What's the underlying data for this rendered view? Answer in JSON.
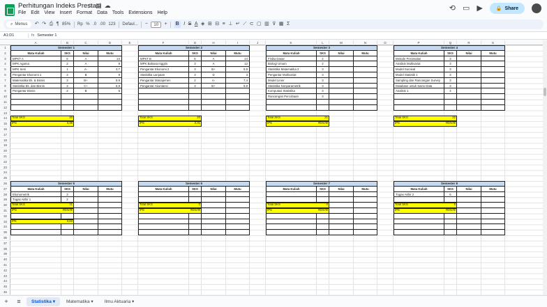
{
  "doc": {
    "title": "Perhitungan Indeks Prestasi"
  },
  "menu": [
    "File",
    "Edit",
    "View",
    "Insert",
    "Format",
    "Data",
    "Tools",
    "Extensions",
    "Help"
  ],
  "share_label": "Share",
  "toolbar": {
    "search": "Menus",
    "zoom": "85%",
    "currency": "Rp",
    "percent": "%",
    "dec1": ".0",
    "dec2": ".00",
    "numfmt": "123",
    "font": "Defaul...",
    "fontsize": "10"
  },
  "formula": {
    "cell": "A1:D1",
    "content": "Semester 1"
  },
  "columns": [
    "A",
    "B",
    "C",
    "D",
    "E",
    "F",
    "G",
    "H",
    "I",
    "J",
    "K",
    "L",
    "M",
    "N",
    "O",
    "P",
    "Q",
    "R",
    "S"
  ],
  "colors": {
    "header_band": "#c5d9f1",
    "highlight": "#ffff00",
    "active_tab": "#0b57d0"
  },
  "semesters": [
    {
      "title": "Semester 1",
      "headers": [
        "Mata Kuliah",
        "SKS",
        "Nilai",
        "Mutu"
      ],
      "rows": [
        [
          "MPKT A",
          "6",
          "A",
          "24"
        ],
        [
          "MPK Agama",
          "2",
          "A",
          "8"
        ],
        [
          "MPK Seni",
          "1",
          "A-",
          "3,7"
        ],
        [
          "Pengantar Ekonomi 1",
          "3",
          "B",
          "9"
        ],
        [
          "Matematika Ek. & Bisnis",
          "3",
          "B+",
          "9,9"
        ],
        [
          "Statistika Ek. dan Bisnis",
          "3",
          "C+",
          "6,9"
        ],
        [
          "Pengantar Bisnis",
          "2",
          "B",
          "6"
        ]
      ],
      "total_sks_label": "Total SKS",
      "total_sks": "20",
      "ips_label": "IPS",
      "ips": "3,38"
    },
    {
      "title": "Semester 2",
      "headers": [
        "Mata Kuliah",
        "SKS",
        "Nilai",
        "Mutu"
      ],
      "rows": [
        [
          "MPKT B",
          "6",
          "A",
          "24"
        ],
        [
          "MPK Bahasa Inggris",
          "3",
          "A",
          "12"
        ],
        [
          "Pengantar Ekonomi 2",
          "3",
          "B+",
          "9,9"
        ],
        [
          "Statistika Lanjutan",
          "3",
          "D",
          "3"
        ],
        [
          "Pengantar Manajemen",
          "2",
          "A-",
          "7,4"
        ],
        [
          "Pengantar Akuntansi",
          "3",
          "B+",
          "9,9"
        ]
      ],
      "total_sks_label": "Total SKS",
      "total_sks": "20",
      "ips_label": "IPS",
      "ips": "3,31"
    },
    {
      "title": "Semester 3",
      "headers": [
        "Mata Kuliah",
        "SKS",
        "Nilai",
        "Mutu"
      ],
      "rows": [
        [
          "Fisika Dasar",
          "2",
          "",
          ""
        ],
        [
          "Biologi Umum",
          "2",
          "",
          ""
        ],
        [
          "Statistika Matematika 2",
          "3",
          "",
          ""
        ],
        [
          "Pengantar Multivariat",
          "3",
          "",
          ""
        ],
        [
          "Model Linier",
          "3",
          "",
          ""
        ],
        [
          "Statistika Nonparametrik",
          "3",
          "",
          ""
        ],
        [
          "Komputasi Statistika",
          "3",
          "",
          ""
        ],
        [
          "Rancangan Percobaan",
          "3",
          "",
          ""
        ]
      ],
      "total_sks_label": "Total SKS",
      "total_sks": "21",
      "ips_label": "IPS",
      "ips": "#DIV/0!"
    },
    {
      "title": "Semester 4",
      "headers": [
        "Mata Kuliah",
        "SKS",
        "Nilai",
        "Mutu"
      ],
      "rows": [
        [
          "Metode Peramalan",
          "3",
          "",
          ""
        ],
        [
          "Analisis Multivariat",
          "3",
          "",
          ""
        ],
        [
          "Model Survival",
          "3",
          "",
          ""
        ],
        [
          "Model Statistik 1",
          "3",
          "",
          ""
        ],
        [
          "Sampling dan Rancangan Survey",
          "3",
          "",
          ""
        ],
        [
          "Database untuk Sains Data",
          "3",
          "",
          ""
        ],
        [
          "Analisis 1",
          "4",
          "",
          ""
        ]
      ],
      "total_sks_label": "Total SKS",
      "total_sks": "22",
      "ips_label": "IPS",
      "ips": "#DIV/0!"
    },
    {
      "title": "Semester 5",
      "headers": [
        "Mata Kuliah",
        "SKS",
        "Nilai",
        "Mutu"
      ],
      "rows": [
        [
          "Ekonometrik",
          "3",
          "",
          ""
        ],
        [
          "Tugas Akhir 1",
          "2",
          "",
          ""
        ],
        [
          "Analisis data kategorik",
          "3",
          "",
          ""
        ],
        [
          "Data mining & business intelligence",
          "3",
          "",
          ""
        ]
      ],
      "total_sks_label": "Total SKS",
      "total_sks": "11",
      "ips_label": "IPS",
      "ips": "#DIV/0!"
    },
    {
      "title": "Semester 6",
      "headers": [
        "Mata Kuliah",
        "SKS",
        "Nilai",
        "Mutu"
      ],
      "rows": [],
      "total_sks_label": "Total SKS",
      "total_sks": "0",
      "ips_label": "IPS",
      "ips": "#DIV/0!"
    },
    {
      "title": "Semester 7",
      "headers": [
        "Mata Kuliah",
        "SKS",
        "Nilai",
        "Mutu"
      ],
      "rows": [],
      "total_sks_label": "Total SKS",
      "total_sks": "0",
      "ips_label": "IPS",
      "ips": "#DIV/0!"
    },
    {
      "title": "Semester 8",
      "headers": [
        "Mata Kuliah",
        "SKS",
        "Nilai",
        "Mutu"
      ],
      "rows": [
        [
          "Tugas Akhir 2",
          "6",
          "",
          ""
        ]
      ],
      "total_sks_label": "Total SKS",
      "total_sks": "6",
      "ips_label": "IPS",
      "ips": "#DIV/0!"
    }
  ],
  "ipk": {
    "label": "IPK",
    "value": "3,63"
  },
  "sheets": [
    "Statistika",
    "Matematika",
    "Ilmu Aktuaria"
  ]
}
